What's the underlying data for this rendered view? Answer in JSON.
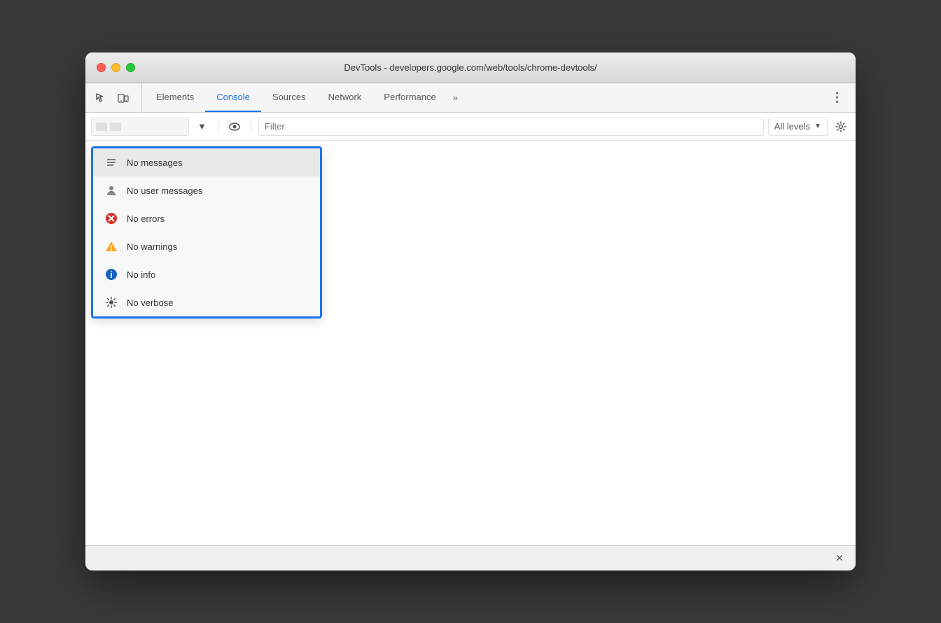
{
  "window": {
    "title": "DevTools - developers.google.com/web/tools/chrome-devtools/"
  },
  "tabs": [
    {
      "id": "elements",
      "label": "Elements",
      "active": false
    },
    {
      "id": "console",
      "label": "Console",
      "active": true
    },
    {
      "id": "sources",
      "label": "Sources",
      "active": false
    },
    {
      "id": "network",
      "label": "Network",
      "active": false
    },
    {
      "id": "performance",
      "label": "Performance",
      "active": false
    },
    {
      "id": "more",
      "label": "»",
      "active": false
    }
  ],
  "toolbar": {
    "filter_placeholder": "Filter",
    "all_levels_label": "All levels",
    "dropdown_arrow": "▼"
  },
  "dropdown": {
    "items": [
      {
        "id": "messages",
        "label": "No messages",
        "icon_type": "messages"
      },
      {
        "id": "user_messages",
        "label": "No user messages",
        "icon_type": "user"
      },
      {
        "id": "errors",
        "label": "No errors",
        "icon_type": "error"
      },
      {
        "id": "warnings",
        "label": "No warnings",
        "icon_type": "warning"
      },
      {
        "id": "info",
        "label": "No info",
        "icon_type": "info"
      },
      {
        "id": "verbose",
        "label": "No verbose",
        "icon_type": "verbose"
      }
    ]
  },
  "colors": {
    "accent": "#1a73e8",
    "error_red": "#d93025",
    "warning_yellow": "#f9a825",
    "info_blue": "#1565c0"
  }
}
